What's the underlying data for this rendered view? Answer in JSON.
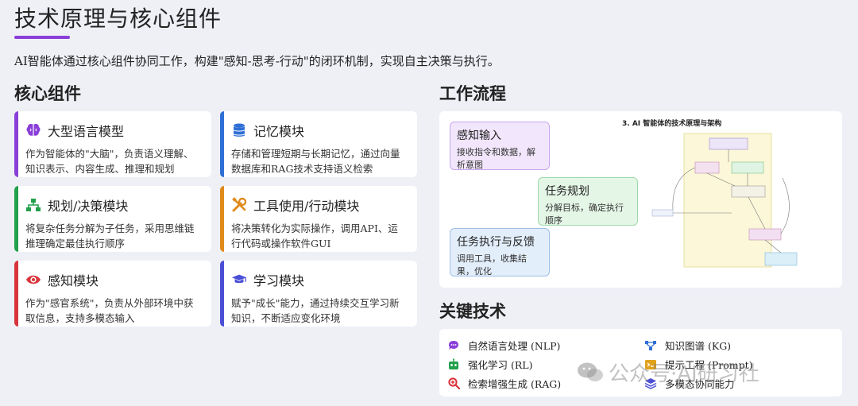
{
  "header": {
    "title": "技术原理与核心组件",
    "subtitle": "AI智能体通过核心组件协同工作，构建\"感知-思考-行动\"的闭环机制，实现自主决策与执行。"
  },
  "core": {
    "section_title": "核心组件",
    "cards": [
      {
        "title": "大型语言模型",
        "desc": "作为智能体的\"大脑\"，负责语义理解、知识表示、内容生成、推理和规划",
        "icon": "brain-icon",
        "accent": "#8b3fd9"
      },
      {
        "title": "记忆模块",
        "desc": "存储和管理短期与长期记忆，通过向量数据库和RAG技术支持语义检索",
        "icon": "database-icon",
        "accent": "#2f6fd6"
      },
      {
        "title": "规划/决策模块",
        "desc": "将复杂任务分解为子任务，采用思维链推理确定最佳执行顺序",
        "icon": "sitemap-icon",
        "accent": "#22a04b"
      },
      {
        "title": "工具使用/行动模块",
        "desc": "将决策转化为实际操作，调用API、运行代码或操作软件GUI",
        "icon": "tools-icon",
        "accent": "#e08a1c"
      },
      {
        "title": "感知模块",
        "desc": "作为\"感官系统\"，负责从外部环境中获取信息，支持多模态输入",
        "icon": "eye-icon",
        "accent": "#d8343b"
      },
      {
        "title": "学习模块",
        "desc": "赋予\"成长\"能力，通过持续交互学习新知识，不断适应变化环境",
        "icon": "graduation-cap-icon",
        "accent": "#4b4fd6"
      }
    ]
  },
  "workflow": {
    "section_title": "工作流程",
    "steps": [
      {
        "title": "感知输入",
        "desc": "接收指令和数据，解析意图"
      },
      {
        "title": "任务规划",
        "desc": "分解目标，确定执行顺序"
      },
      {
        "title": "任务执行与反馈",
        "desc": "调用工具，收集结果，优化"
      }
    ],
    "diagram_title": "3. AI 智能体的技术原理与架构"
  },
  "key_tech": {
    "section_title": "关键技术",
    "items": [
      {
        "label": "自然语言处理 (NLP)",
        "icon": "chat-icon",
        "color": "#8b3fd9"
      },
      {
        "label": "知识图谱 (KG)",
        "icon": "graph-icon",
        "color": "#2f6fd6"
      },
      {
        "label": "强化学习 (RL)",
        "icon": "robot-icon",
        "color": "#22a04b"
      },
      {
        "label": "提示工程 (Prompt)",
        "icon": "terminal-icon",
        "color": "#e0a21c"
      },
      {
        "label": "检索增强生成 (RAG)",
        "icon": "search-plus-icon",
        "color": "#d8343b"
      },
      {
        "label": "多模态协同能力",
        "icon": "layers-icon",
        "color": "#4b4fd6"
      }
    ]
  },
  "watermark": {
    "text": "公众号·AI研习社"
  },
  "colors": {
    "accent": "#8b3fd9",
    "background": "#eef0f6"
  }
}
